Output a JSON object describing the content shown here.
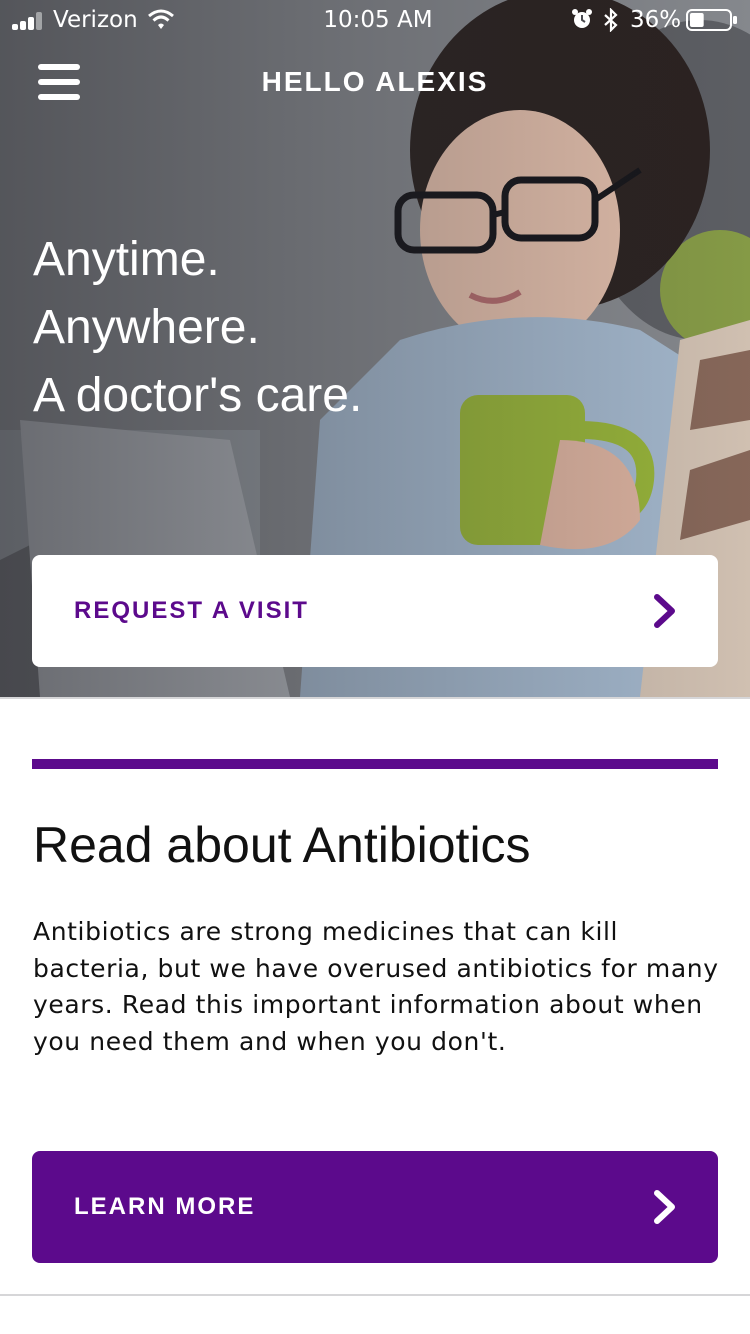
{
  "status_bar": {
    "carrier": "Verizon",
    "time": "10:05 AM",
    "battery_percent": "36%",
    "battery_level": 0.36,
    "signal_icon": "cellular-signal-icon",
    "wifi_icon": "wifi-icon",
    "alarm_icon": "alarm-clock-icon",
    "bluetooth_icon": "bluetooth-icon",
    "battery_icon": "battery-icon"
  },
  "header": {
    "greeting": "HELLO ALEXIS",
    "menu_icon": "hamburger-menu-icon"
  },
  "hero": {
    "tagline": [
      "Anytime.",
      "Anywhere.",
      "A doctor's care."
    ],
    "request_button_label": "REQUEST A VISIT",
    "request_button_icon": "chevron-right-icon"
  },
  "article": {
    "title": "Read about Antibiotics",
    "body": "Antibiotics are strong medicines that can kill bacteria, but we have overused antibiotics for many years. Read this important information about when you need them and when you don't.",
    "button_label": "LEARN MORE",
    "button_icon": "chevron-right-icon"
  },
  "colors": {
    "brand_purple": "#5c0a8c",
    "text_dark": "#111111",
    "divider": "#d6d6d8",
    "white": "#ffffff"
  }
}
